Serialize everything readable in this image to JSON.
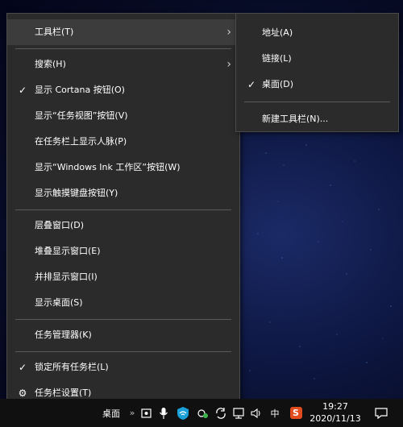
{
  "main_menu": {
    "toolbars": "工具栏(T)",
    "search": "搜索(H)",
    "show_cortana": "显示 Cortana 按钮(O)",
    "show_task_view": "显示“任务视图”按钮(V)",
    "show_people": "在任务栏上显示人脉(P)",
    "show_ink": "显示“Windows Ink 工作区”按钮(W)",
    "show_touch_keyboard": "显示触摸键盘按钮(Y)",
    "cascade": "层叠窗口(D)",
    "stacked": "堆叠显示窗口(E)",
    "side_by_side": "并排显示窗口(I)",
    "show_desktop": "显示桌面(S)",
    "task_manager": "任务管理器(K)",
    "lock_taskbars": "锁定所有任务栏(L)",
    "taskbar_settings": "任务栏设置(T)"
  },
  "sub_menu": {
    "address": "地址(A)",
    "links": "链接(L)",
    "desktop": "桌面(D)",
    "new_toolbar": "新建工具栏(N)..."
  },
  "glyphs": {
    "check": "✓",
    "arrow": "›",
    "gear": "⚙"
  },
  "taskbar": {
    "desktop_label": "桌面",
    "overflow": "»",
    "ime_lang": "中",
    "ime_brand": "S",
    "time": "19:27",
    "date": "2020/11/13"
  }
}
